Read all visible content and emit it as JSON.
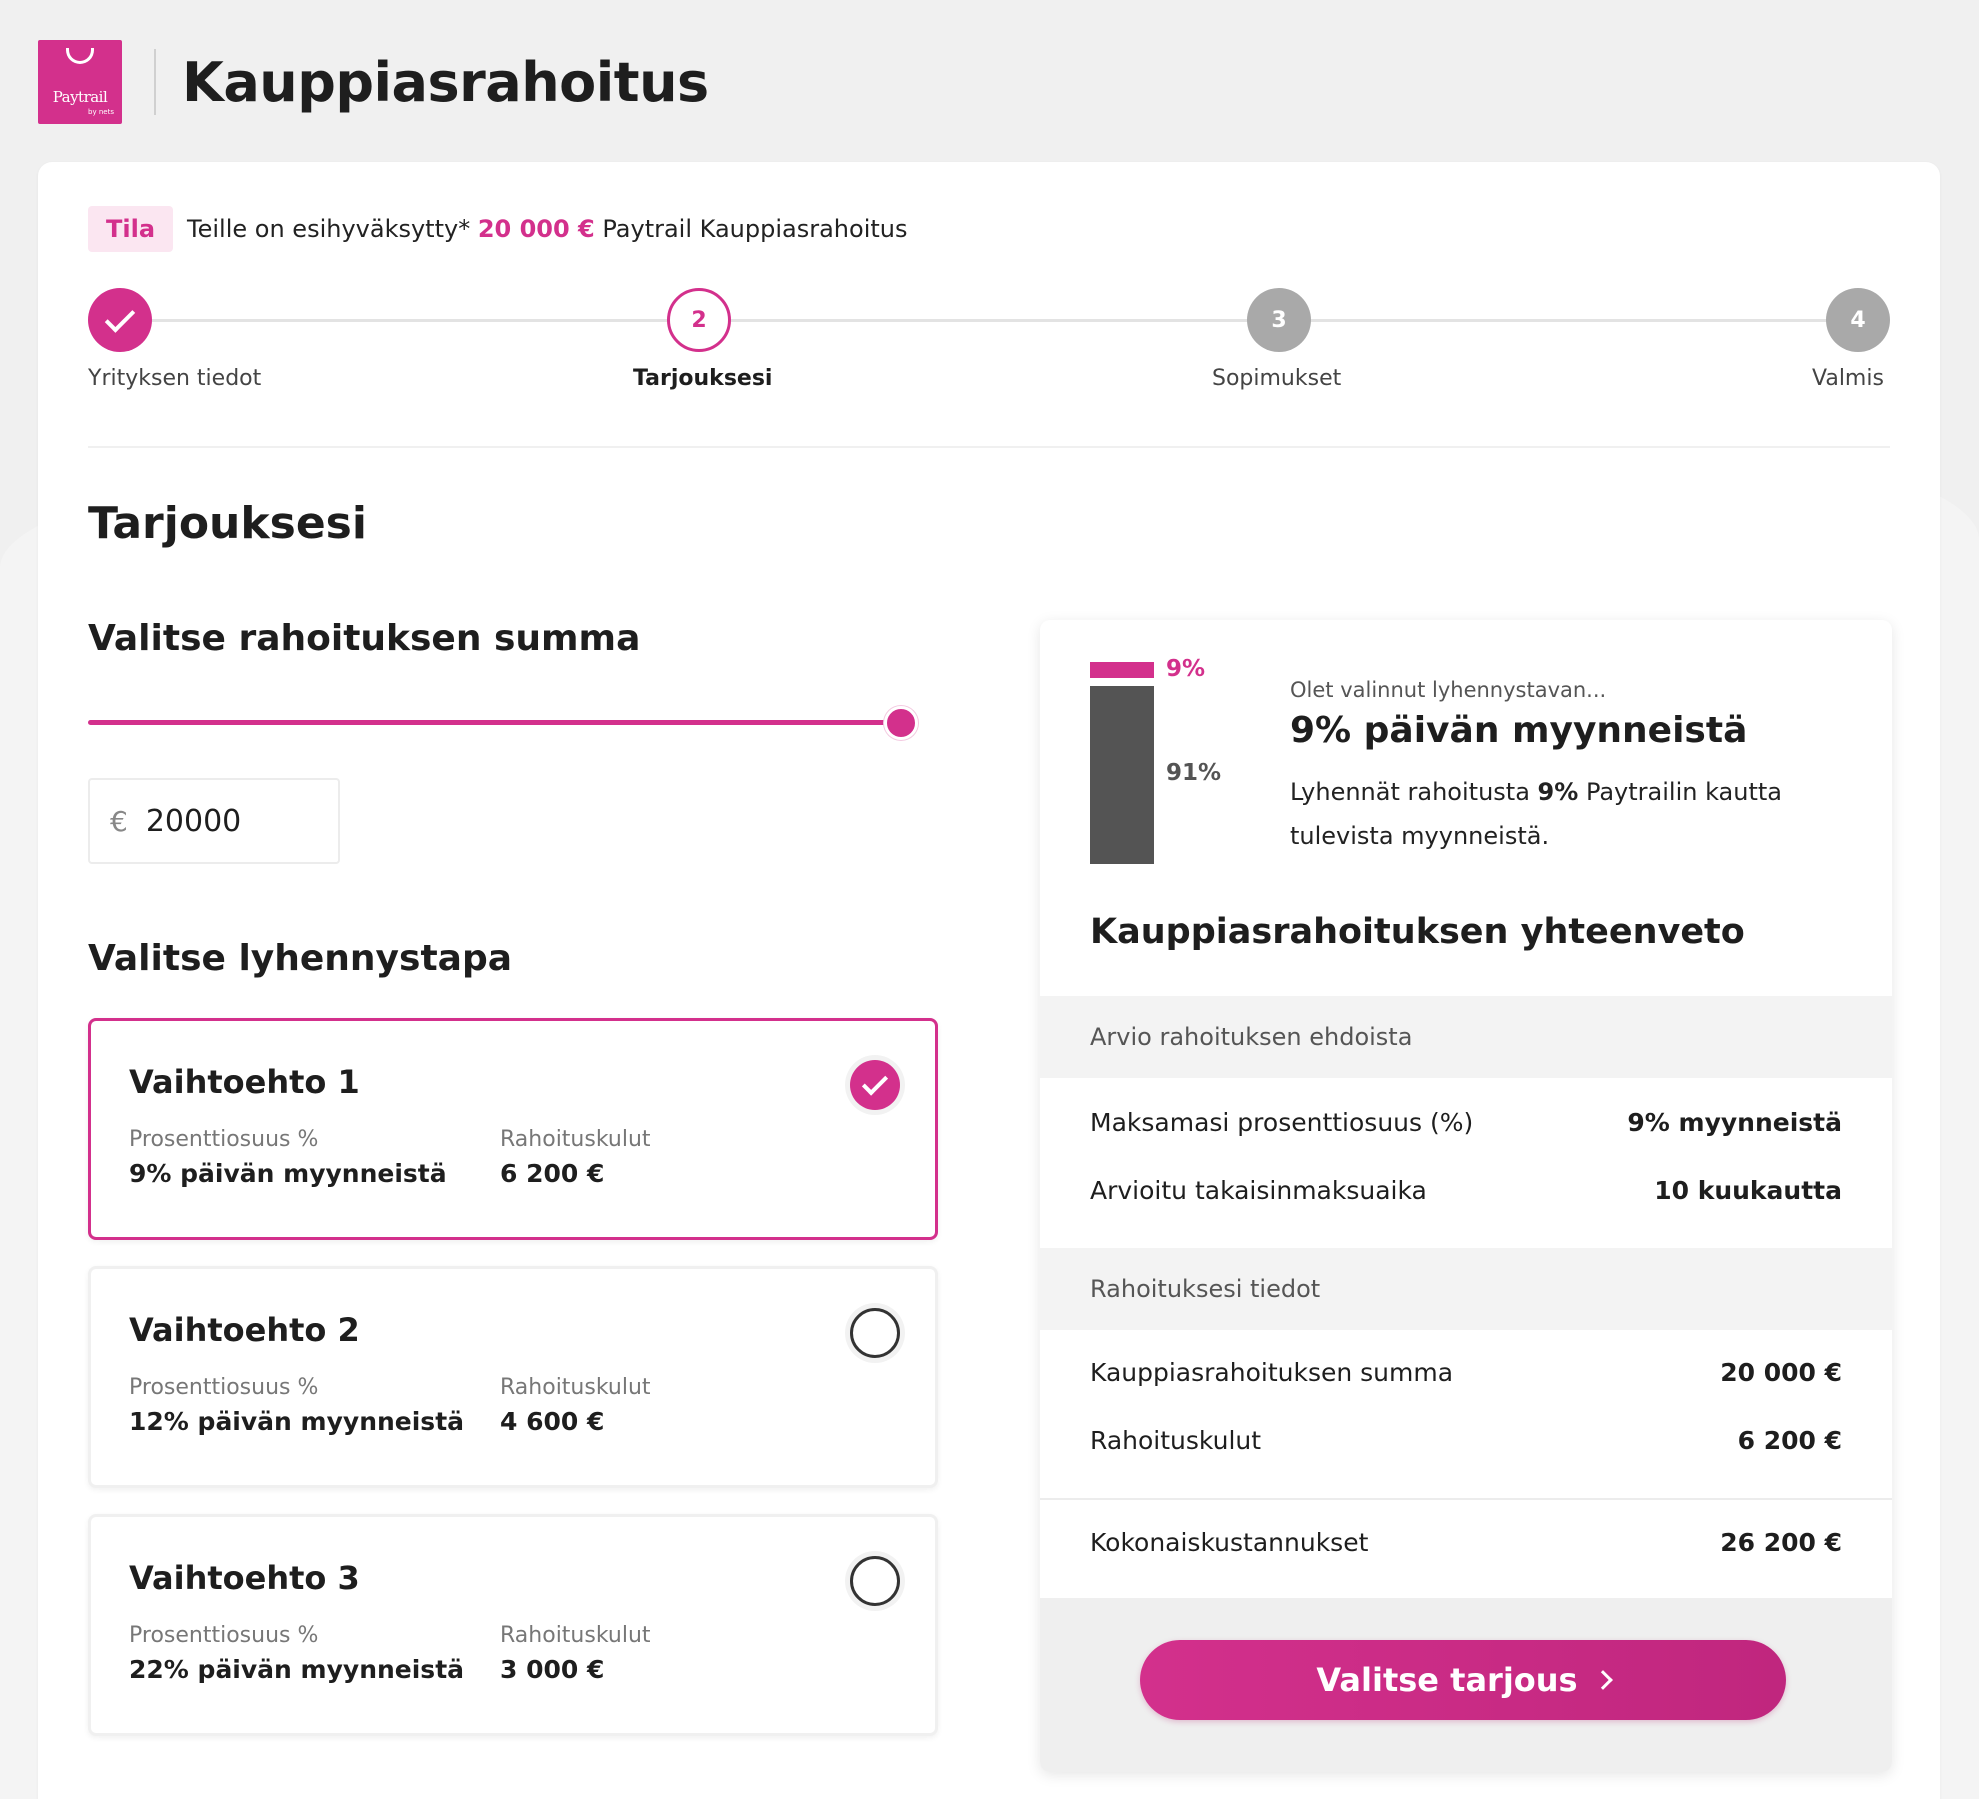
{
  "header": {
    "logo_text": "Paytrail",
    "logo_sub": "by nets",
    "title": "Kauppiasrahoitus"
  },
  "status": {
    "badge": "Tila",
    "text_before": "Teille on esihyväksytty*",
    "amount": "20 000 €",
    "text_after": "Paytrail Kauppiasrahoitus"
  },
  "stepper": [
    {
      "number": "1",
      "label": "Yrityksen tiedot",
      "state": "done"
    },
    {
      "number": "2",
      "label": "Tarjouksesi",
      "state": "active"
    },
    {
      "number": "3",
      "label": "Sopimukset",
      "state": "todo"
    },
    {
      "number": "4",
      "label": "Valmis",
      "state": "todo"
    }
  ],
  "main": {
    "title": "Tarjouksesi",
    "amount_heading": "Valitse rahoituksen summa",
    "slider_value_fraction": 1.0,
    "currency_symbol": "€",
    "amount_value": "20000",
    "method_heading": "Valitse lyhennystapa"
  },
  "options": [
    {
      "title": "Vaihtoehto 1",
      "pct_label": "Prosenttiosuus %",
      "pct_value": "9% päivän myynneistä",
      "cost_label": "Rahoituskulut",
      "cost_value": "6 200 €",
      "selected": true
    },
    {
      "title": "Vaihtoehto 2",
      "pct_label": "Prosenttiosuus %",
      "pct_value": "12% päivän myynneistä",
      "cost_label": "Rahoituskulut",
      "cost_value": "4 600 €",
      "selected": false
    },
    {
      "title": "Vaihtoehto 3",
      "pct_label": "Prosenttiosuus %",
      "pct_value": "22% päivän myynneistä",
      "cost_label": "Rahoituskulut",
      "cost_value": "3 000 €",
      "selected": false
    }
  ],
  "summary": {
    "bar_top_label": "9%",
    "bar_bottom_label": "91%",
    "chosen_intro": "Olet valinnut lyhennystavan...",
    "chosen_title": "9% päivän myynneistä",
    "desc_before": "Lyhennät rahoitusta",
    "desc_pct": "9%",
    "desc_after": "Paytrailin kautta tulevista myynneistä.",
    "heading": "Kauppiasrahoituksen yhteenveto",
    "section1_title": "Arvio rahoituksen ehdoista",
    "section1_rows": [
      {
        "label": "Maksamasi prosenttiosuus (%)",
        "value": "9% myynneistä"
      },
      {
        "label": "Arvioitu takaisinmaksuaika",
        "value": "10 kuukautta"
      }
    ],
    "section2_title": "Rahoituksesi tiedot",
    "section2_rows": [
      {
        "label": "Kauppiasrahoituksen summa",
        "value": "20 000 €"
      },
      {
        "label": "Rahoituskulut",
        "value": "6 200 €"
      }
    ],
    "total": {
      "label": "Kokonaiskustannukset",
      "value": "26 200 €"
    },
    "cta": "Valitse tarjous"
  },
  "colors": {
    "accent": "#d3308c",
    "dark_bar": "#545454",
    "step_todo": "#a9a9a9"
  }
}
